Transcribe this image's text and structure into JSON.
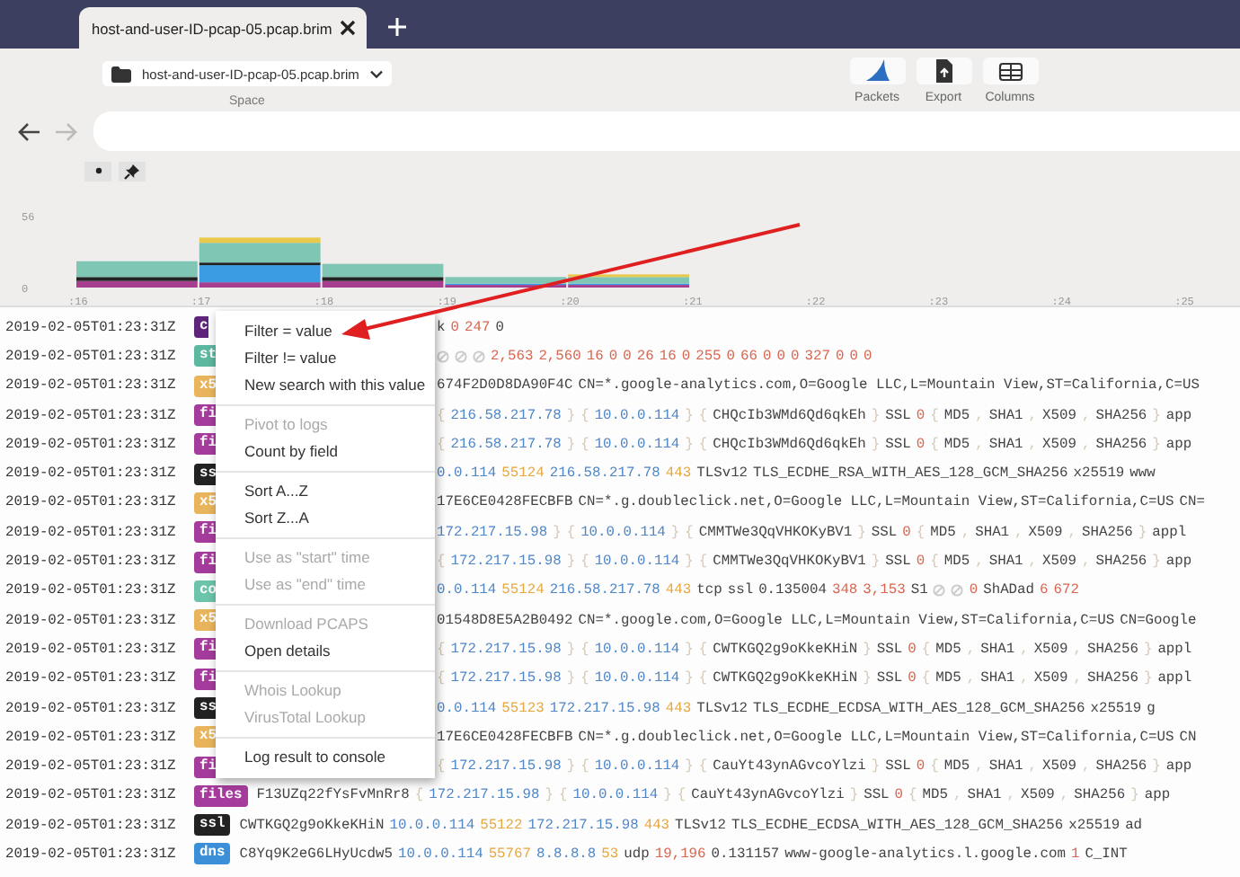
{
  "tab": {
    "title": "host-and-user-ID-pcap-05.pcap.brim"
  },
  "space": {
    "value": "host-and-user-ID-pcap-05.pcap.brim",
    "label": "Space"
  },
  "toolbar_buttons": [
    {
      "kind": "packets",
      "label": "Packets"
    },
    {
      "kind": "export",
      "label": "Export"
    },
    {
      "kind": "columns",
      "label": "Columns"
    }
  ],
  "chart": {
    "chart_data": {
      "type": "bar",
      "stacked": true,
      "categories": [
        ":16",
        ":17",
        ":18",
        ":19",
        ":20",
        ":21",
        ":22",
        ":23",
        ":24",
        ":25"
      ],
      "yticks": [
        {
          "value": 0,
          "label": "0"
        },
        {
          "value": 56,
          "label": "56"
        }
      ],
      "ylim": [
        0,
        56
      ],
      "series": [
        {
          "color": "#a63d8f",
          "values": [
            5,
            4,
            5,
            2,
            2,
            0,
            0,
            0,
            0,
            0
          ]
        },
        {
          "color": "#3b9be3",
          "values": [
            0,
            13,
            0,
            1,
            1,
            0,
            0,
            0,
            0,
            0
          ]
        },
        {
          "color": "#222222",
          "values": [
            3,
            2,
            3,
            0,
            0,
            0,
            0,
            0,
            0,
            0
          ]
        },
        {
          "color": "#7fc6b4",
          "values": [
            12,
            15,
            10,
            5,
            5,
            0,
            0,
            0,
            0,
            0
          ]
        },
        {
          "color": "#e9c94c",
          "values": [
            0,
            4,
            0,
            0,
            2,
            0,
            0,
            0,
            0,
            0
          ]
        }
      ]
    }
  },
  "rows": [
    {
      "time": "2019-02-05T01:23:31Z",
      "badge": "c",
      "color": "#5d2479",
      "under_menu": true,
      "fields": [
        {
          "kind": "text",
          "text": "k"
        },
        {
          "kind": "num",
          "text": "0"
        },
        {
          "kind": "num",
          "text": "247"
        },
        {
          "kind": "text",
          "text": "0"
        }
      ]
    },
    {
      "time": "2019-02-05T01:23:31Z",
      "badge": "st",
      "color": "#5cb8a0",
      "under_menu": true,
      "fields": [
        {
          "kind": "unset"
        },
        {
          "kind": "unset"
        },
        {
          "kind": "unset"
        },
        {
          "kind": "num",
          "text": "2,563"
        },
        {
          "kind": "num",
          "text": "2,560"
        },
        {
          "kind": "num",
          "text": "16"
        },
        {
          "kind": "num",
          "text": "0"
        },
        {
          "kind": "num",
          "text": "0"
        },
        {
          "kind": "num",
          "text": "26"
        },
        {
          "kind": "num",
          "text": "16"
        },
        {
          "kind": "num",
          "text": "0"
        },
        {
          "kind": "num",
          "text": "255"
        },
        {
          "kind": "num",
          "text": "0"
        },
        {
          "kind": "num",
          "text": "66"
        },
        {
          "kind": "num",
          "text": "0"
        },
        {
          "kind": "num",
          "text": "0"
        },
        {
          "kind": "num",
          "text": "0"
        },
        {
          "kind": "num",
          "text": "327"
        },
        {
          "kind": "num",
          "text": "0"
        },
        {
          "kind": "num",
          "text": "0"
        },
        {
          "kind": "num",
          "text": "0"
        }
      ]
    },
    {
      "time": "2019-02-05T01:23:31Z",
      "badge": "x5",
      "color": "#e9b55c",
      "under_menu": true,
      "fields": [
        {
          "kind": "text",
          "text": "674F2D0D8DA90F4C"
        },
        {
          "kind": "text",
          "text": "CN=*.google-analytics.com,O=Google LLC,L=Mountain View,ST=California,C=US"
        }
      ]
    },
    {
      "time": "2019-02-05T01:23:31Z",
      "badge": "fi",
      "color": "#a53b9c",
      "under_menu": true,
      "fields": [
        {
          "kind": "brace",
          "text": "{"
        },
        {
          "kind": "ip",
          "text": "216.58.217.78"
        },
        {
          "kind": "brace",
          "text": "}"
        },
        {
          "kind": "brace",
          "text": "{"
        },
        {
          "kind": "ip",
          "text": "10.0.0.114"
        },
        {
          "kind": "brace",
          "text": "}"
        },
        {
          "kind": "brace",
          "text": "{"
        },
        {
          "kind": "text",
          "text": "CHQcIb3WMd6Qd6qkEh"
        },
        {
          "kind": "brace",
          "text": "}"
        },
        {
          "kind": "text",
          "text": "SSL"
        },
        {
          "kind": "num",
          "text": "0"
        },
        {
          "kind": "brace",
          "text": "{"
        },
        {
          "kind": "text",
          "text": "MD5"
        },
        {
          "kind": "brace",
          "text": ","
        },
        {
          "kind": "text",
          "text": "SHA1"
        },
        {
          "kind": "brace",
          "text": ","
        },
        {
          "kind": "text",
          "text": "X509"
        },
        {
          "kind": "brace",
          "text": ","
        },
        {
          "kind": "text",
          "text": "SHA256"
        },
        {
          "kind": "brace",
          "text": "}"
        },
        {
          "kind": "text",
          "text": "app"
        }
      ]
    },
    {
      "time": "2019-02-05T01:23:31Z",
      "badge": "fi",
      "color": "#a53b9c",
      "under_menu": true,
      "fields": [
        {
          "kind": "brace",
          "text": "{"
        },
        {
          "kind": "ip",
          "text": "216.58.217.78"
        },
        {
          "kind": "brace",
          "text": "}"
        },
        {
          "kind": "brace",
          "text": "{"
        },
        {
          "kind": "ip",
          "text": "10.0.0.114"
        },
        {
          "kind": "brace",
          "text": "}"
        },
        {
          "kind": "brace",
          "text": "{"
        },
        {
          "kind": "text",
          "text": "CHQcIb3WMd6Qd6qkEh"
        },
        {
          "kind": "brace",
          "text": "}"
        },
        {
          "kind": "text",
          "text": "SSL"
        },
        {
          "kind": "num",
          "text": "0"
        },
        {
          "kind": "brace",
          "text": "{"
        },
        {
          "kind": "text",
          "text": "MD5"
        },
        {
          "kind": "brace",
          "text": ","
        },
        {
          "kind": "text",
          "text": "SHA1"
        },
        {
          "kind": "brace",
          "text": ","
        },
        {
          "kind": "text",
          "text": "X509"
        },
        {
          "kind": "brace",
          "text": ","
        },
        {
          "kind": "text",
          "text": "SHA256"
        },
        {
          "kind": "brace",
          "text": "}"
        },
        {
          "kind": "text",
          "text": "app"
        }
      ]
    },
    {
      "time": "2019-02-05T01:23:31Z",
      "badge": "ss",
      "color": "#222222",
      "under_menu": true,
      "fields": [
        {
          "kind": "ip",
          "text": "0.0.114"
        },
        {
          "kind": "port",
          "text": "55124"
        },
        {
          "kind": "ip",
          "text": "216.58.217.78"
        },
        {
          "kind": "port",
          "text": "443"
        },
        {
          "kind": "text",
          "text": "TLSv12"
        },
        {
          "kind": "text",
          "text": "TLS_ECDHE_RSA_WITH_AES_128_GCM_SHA256"
        },
        {
          "kind": "text",
          "text": "x25519"
        },
        {
          "kind": "text",
          "text": "www"
        }
      ]
    },
    {
      "time": "2019-02-05T01:23:31Z",
      "badge": "x5",
      "color": "#e9b55c",
      "under_menu": true,
      "fields": [
        {
          "kind": "text",
          "text": "17E6CE0428FECBFB"
        },
        {
          "kind": "text",
          "text": "CN=*.g.doubleclick.net,O=Google LLC,L=Mountain View,ST=California,C=US"
        },
        {
          "kind": "text",
          "text": "CN="
        }
      ]
    },
    {
      "time": "2019-02-05T01:23:31Z",
      "badge": "fi",
      "color": "#a53b9c",
      "under_menu": true,
      "fields": [
        {
          "kind": "ip",
          "text": "172.217.15.98"
        },
        {
          "kind": "brace",
          "text": "}"
        },
        {
          "kind": "brace",
          "text": "{"
        },
        {
          "kind": "ip",
          "text": "10.0.0.114"
        },
        {
          "kind": "brace",
          "text": "}"
        },
        {
          "kind": "brace",
          "text": "{"
        },
        {
          "kind": "text",
          "text": "CMMTWe3QqVHKOKyBV1"
        },
        {
          "kind": "brace",
          "text": "}"
        },
        {
          "kind": "text",
          "text": "SSL"
        },
        {
          "kind": "num",
          "text": "0"
        },
        {
          "kind": "brace",
          "text": "{"
        },
        {
          "kind": "text",
          "text": "MD5"
        },
        {
          "kind": "brace",
          "text": ","
        },
        {
          "kind": "text",
          "text": "SHA1"
        },
        {
          "kind": "brace",
          "text": ","
        },
        {
          "kind": "text",
          "text": "X509"
        },
        {
          "kind": "brace",
          "text": ","
        },
        {
          "kind": "text",
          "text": "SHA256"
        },
        {
          "kind": "brace",
          "text": "}"
        },
        {
          "kind": "text",
          "text": "appl"
        }
      ]
    },
    {
      "time": "2019-02-05T01:23:31Z",
      "badge": "fi",
      "color": "#a53b9c",
      "under_menu": true,
      "fields": [
        {
          "kind": "brace",
          "text": "{"
        },
        {
          "kind": "ip",
          "text": "172.217.15.98"
        },
        {
          "kind": "brace",
          "text": "}"
        },
        {
          "kind": "brace",
          "text": "{"
        },
        {
          "kind": "ip",
          "text": "10.0.0.114"
        },
        {
          "kind": "brace",
          "text": "}"
        },
        {
          "kind": "brace",
          "text": "{"
        },
        {
          "kind": "text",
          "text": "CMMTWe3QqVHKOKyBV1"
        },
        {
          "kind": "brace",
          "text": "}"
        },
        {
          "kind": "text",
          "text": "SSL"
        },
        {
          "kind": "num",
          "text": "0"
        },
        {
          "kind": "brace",
          "text": "{"
        },
        {
          "kind": "text",
          "text": "MD5"
        },
        {
          "kind": "brace",
          "text": ","
        },
        {
          "kind": "text",
          "text": "SHA1"
        },
        {
          "kind": "brace",
          "text": ","
        },
        {
          "kind": "text",
          "text": "X509"
        },
        {
          "kind": "brace",
          "text": ","
        },
        {
          "kind": "text",
          "text": "SHA256"
        },
        {
          "kind": "brace",
          "text": "}"
        },
        {
          "kind": "text",
          "text": "app"
        }
      ]
    },
    {
      "time": "2019-02-05T01:23:31Z",
      "badge": "co",
      "color": "#6cc4ab",
      "under_menu": true,
      "fields": [
        {
          "kind": "ip",
          "text": "0.0.114"
        },
        {
          "kind": "port",
          "text": "55124"
        },
        {
          "kind": "ip",
          "text": "216.58.217.78"
        },
        {
          "kind": "port",
          "text": "443"
        },
        {
          "kind": "text",
          "text": "tcp"
        },
        {
          "kind": "text",
          "text": "ssl"
        },
        {
          "kind": "text",
          "text": "0.135004"
        },
        {
          "kind": "num",
          "text": "348"
        },
        {
          "kind": "num",
          "text": "3,153"
        },
        {
          "kind": "text",
          "text": "S1"
        },
        {
          "kind": "unset"
        },
        {
          "kind": "unset"
        },
        {
          "kind": "num",
          "text": "0"
        },
        {
          "kind": "text",
          "text": "ShADad"
        },
        {
          "kind": "num",
          "text": "6"
        },
        {
          "kind": "num",
          "text": "672"
        }
      ]
    },
    {
      "time": "2019-02-05T01:23:31Z",
      "badge": "x5",
      "color": "#e9b55c",
      "under_menu": true,
      "fields": [
        {
          "kind": "text",
          "text": "01548D8E5A2B0492"
        },
        {
          "kind": "text",
          "text": "CN=*.google.com,O=Google LLC,L=Mountain View,ST=California,C=US"
        },
        {
          "kind": "text",
          "text": "CN=Google"
        }
      ]
    },
    {
      "time": "2019-02-05T01:23:31Z",
      "badge": "fi",
      "color": "#a53b9c",
      "under_menu": true,
      "fields": [
        {
          "kind": "brace",
          "text": "{"
        },
        {
          "kind": "ip",
          "text": "172.217.15.98"
        },
        {
          "kind": "brace",
          "text": "}"
        },
        {
          "kind": "brace",
          "text": "{"
        },
        {
          "kind": "ip",
          "text": "10.0.0.114"
        },
        {
          "kind": "brace",
          "text": "}"
        },
        {
          "kind": "brace",
          "text": "{"
        },
        {
          "kind": "text",
          "text": "CWTKGQ2g9oKkeKHiN"
        },
        {
          "kind": "brace",
          "text": "}"
        },
        {
          "kind": "text",
          "text": "SSL"
        },
        {
          "kind": "num",
          "text": "0"
        },
        {
          "kind": "brace",
          "text": "{"
        },
        {
          "kind": "text",
          "text": "MD5"
        },
        {
          "kind": "brace",
          "text": ","
        },
        {
          "kind": "text",
          "text": "SHA1"
        },
        {
          "kind": "brace",
          "text": ","
        },
        {
          "kind": "text",
          "text": "X509"
        },
        {
          "kind": "brace",
          "text": ","
        },
        {
          "kind": "text",
          "text": "SHA256"
        },
        {
          "kind": "brace",
          "text": "}"
        },
        {
          "kind": "text",
          "text": "appl"
        }
      ]
    },
    {
      "time": "2019-02-05T01:23:31Z",
      "badge": "fi",
      "color": "#a53b9c",
      "under_menu": true,
      "fields": [
        {
          "kind": "brace",
          "text": "{"
        },
        {
          "kind": "ip",
          "text": "172.217.15.98"
        },
        {
          "kind": "brace",
          "text": "}"
        },
        {
          "kind": "brace",
          "text": "{"
        },
        {
          "kind": "ip",
          "text": "10.0.0.114"
        },
        {
          "kind": "brace",
          "text": "}"
        },
        {
          "kind": "brace",
          "text": "{"
        },
        {
          "kind": "text",
          "text": "CWTKGQ2g9oKkeKHiN"
        },
        {
          "kind": "brace",
          "text": "}"
        },
        {
          "kind": "text",
          "text": "SSL"
        },
        {
          "kind": "num",
          "text": "0"
        },
        {
          "kind": "brace",
          "text": "{"
        },
        {
          "kind": "text",
          "text": "MD5"
        },
        {
          "kind": "brace",
          "text": ","
        },
        {
          "kind": "text",
          "text": "SHA1"
        },
        {
          "kind": "brace",
          "text": ","
        },
        {
          "kind": "text",
          "text": "X509"
        },
        {
          "kind": "brace",
          "text": ","
        },
        {
          "kind": "text",
          "text": "SHA256"
        },
        {
          "kind": "brace",
          "text": "}"
        },
        {
          "kind": "text",
          "text": "appl"
        }
      ]
    },
    {
      "time": "2019-02-05T01:23:31Z",
      "badge": "ss",
      "color": "#222222",
      "under_menu": true,
      "fields": [
        {
          "kind": "ip",
          "text": "0.0.114"
        },
        {
          "kind": "port",
          "text": "55123"
        },
        {
          "kind": "ip",
          "text": "172.217.15.98"
        },
        {
          "kind": "port",
          "text": "443"
        },
        {
          "kind": "text",
          "text": "TLSv12"
        },
        {
          "kind": "text",
          "text": "TLS_ECDHE_ECDSA_WITH_AES_128_GCM_SHA256"
        },
        {
          "kind": "text",
          "text": "x25519"
        },
        {
          "kind": "text",
          "text": "g"
        }
      ]
    },
    {
      "time": "2019-02-05T01:23:31Z",
      "badge": "x5",
      "color": "#e9b55c",
      "under_menu": true,
      "fields": [
        {
          "kind": "text",
          "text": "17E6CE0428FECBFB"
        },
        {
          "kind": "text",
          "text": "CN=*.g.doubleclick.net,O=Google LLC,L=Mountain View,ST=California,C=US"
        },
        {
          "kind": "text",
          "text": "CN"
        }
      ]
    },
    {
      "time": "2019-02-05T01:23:31Z",
      "badge": "fi",
      "color": "#a53b9c",
      "under_menu": true,
      "fields": [
        {
          "kind": "brace",
          "text": "{"
        },
        {
          "kind": "ip",
          "text": "172.217.15.98"
        },
        {
          "kind": "brace",
          "text": "}"
        },
        {
          "kind": "brace",
          "text": "{"
        },
        {
          "kind": "ip",
          "text": "10.0.0.114"
        },
        {
          "kind": "brace",
          "text": "}"
        },
        {
          "kind": "brace",
          "text": "{"
        },
        {
          "kind": "text",
          "text": "CauYt43ynAGvcoYlzi"
        },
        {
          "kind": "brace",
          "text": "}"
        },
        {
          "kind": "text",
          "text": "SSL"
        },
        {
          "kind": "num",
          "text": "0"
        },
        {
          "kind": "brace",
          "text": "{"
        },
        {
          "kind": "text",
          "text": "MD5"
        },
        {
          "kind": "brace",
          "text": ","
        },
        {
          "kind": "text",
          "text": "SHA1"
        },
        {
          "kind": "brace",
          "text": ","
        },
        {
          "kind": "text",
          "text": "X509"
        },
        {
          "kind": "brace",
          "text": ","
        },
        {
          "kind": "text",
          "text": "SHA256"
        },
        {
          "kind": "brace",
          "text": "}"
        },
        {
          "kind": "text",
          "text": "app"
        }
      ]
    },
    {
      "time": "2019-02-05T01:23:31Z",
      "badge": "files",
      "color": "#a53b9c",
      "under_menu": false,
      "fields": [
        {
          "kind": "text",
          "text": "F13UZq22fYsFvMnRr8"
        },
        {
          "kind": "brace",
          "text": "{"
        },
        {
          "kind": "ip",
          "text": "172.217.15.98"
        },
        {
          "kind": "brace",
          "text": "}"
        },
        {
          "kind": "brace",
          "text": "{"
        },
        {
          "kind": "ip",
          "text": "10.0.0.114"
        },
        {
          "kind": "brace",
          "text": "}"
        },
        {
          "kind": "brace",
          "text": "{"
        },
        {
          "kind": "text",
          "text": "CauYt43ynAGvcoYlzi"
        },
        {
          "kind": "brace",
          "text": "}"
        },
        {
          "kind": "text",
          "text": "SSL"
        },
        {
          "kind": "num",
          "text": "0"
        },
        {
          "kind": "brace",
          "text": "{"
        },
        {
          "kind": "text",
          "text": "MD5"
        },
        {
          "kind": "brace",
          "text": ","
        },
        {
          "kind": "text",
          "text": "SHA1"
        },
        {
          "kind": "brace",
          "text": ","
        },
        {
          "kind": "text",
          "text": "X509"
        },
        {
          "kind": "brace",
          "text": ","
        },
        {
          "kind": "text",
          "text": "SHA256"
        },
        {
          "kind": "brace",
          "text": "}"
        },
        {
          "kind": "text",
          "text": "app"
        }
      ]
    },
    {
      "time": "2019-02-05T01:23:31Z",
      "badge": "ssl",
      "color": "#222222",
      "under_menu": false,
      "fields": [
        {
          "kind": "text",
          "text": "CWTKGQ2g9oKkeKHiN"
        },
        {
          "kind": "ip",
          "text": "10.0.0.114"
        },
        {
          "kind": "port",
          "text": "55122"
        },
        {
          "kind": "ip",
          "text": "172.217.15.98"
        },
        {
          "kind": "port",
          "text": "443"
        },
        {
          "kind": "text",
          "text": "TLSv12"
        },
        {
          "kind": "text",
          "text": "TLS_ECDHE_ECDSA_WITH_AES_128_GCM_SHA256"
        },
        {
          "kind": "text",
          "text": "x25519"
        },
        {
          "kind": "text",
          "text": "ad"
        }
      ]
    },
    {
      "time": "2019-02-05T01:23:31Z",
      "badge": "dns",
      "color": "#3a8fd8",
      "under_menu": false,
      "fields": [
        {
          "kind": "text",
          "text": "C8Yq9K2eG6LHyUcdw5"
        },
        {
          "kind": "ip",
          "text": "10.0.0.114"
        },
        {
          "kind": "port",
          "text": "55767"
        },
        {
          "kind": "ip",
          "text": "8.8.8.8"
        },
        {
          "kind": "port",
          "text": "53"
        },
        {
          "kind": "text",
          "text": "udp"
        },
        {
          "kind": "num",
          "text": "19,196"
        },
        {
          "kind": "text",
          "text": "0.131157"
        },
        {
          "kind": "text",
          "text": "www-google-analytics.l.google.com"
        },
        {
          "kind": "num",
          "text": "1"
        },
        {
          "kind": "text",
          "text": "C_INT"
        }
      ]
    }
  ],
  "context_menu": {
    "groups": [
      {
        "items": [
          {
            "label": "Filter = value",
            "disabled": false
          },
          {
            "label": "Filter != value",
            "disabled": false
          },
          {
            "label": "New search with this value",
            "disabled": false
          }
        ]
      },
      {
        "items": [
          {
            "label": "Pivot to logs",
            "disabled": true
          },
          {
            "label": "Count by field",
            "disabled": false
          }
        ]
      },
      {
        "items": [
          {
            "label": "Sort A...Z",
            "disabled": false
          },
          {
            "label": "Sort Z...A",
            "disabled": false
          }
        ]
      },
      {
        "items": [
          {
            "label": "Use as \"start\" time",
            "disabled": true
          },
          {
            "label": "Use as \"end\" time",
            "disabled": true
          }
        ]
      },
      {
        "items": [
          {
            "label": "Download PCAPS",
            "disabled": true
          },
          {
            "label": "Open details",
            "disabled": false
          }
        ]
      },
      {
        "items": [
          {
            "label": "Whois Lookup",
            "disabled": true
          },
          {
            "label": "VirusTotal Lookup",
            "disabled": true
          }
        ]
      },
      {
        "items": [
          {
            "label": "Log result to console",
            "disabled": false
          }
        ]
      }
    ]
  }
}
